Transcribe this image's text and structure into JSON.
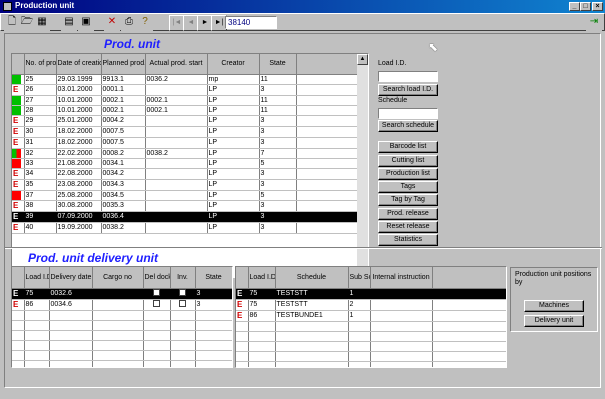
{
  "window": {
    "title": "Production unit"
  },
  "toolbar": {
    "record_counter": "38140",
    "nav_first": "|◄",
    "nav_prev": "◄",
    "nav_next": "►",
    "nav_last": "►|"
  },
  "prod_unit": {
    "heading": "Prod. unit",
    "columns": [
      "No. of prod. unit",
      "Date of creatio",
      "Planned prod.",
      "Actual prod. start",
      "Creator",
      "State"
    ],
    "rows": [
      {
        "no": "25",
        "date": "29.03.1999",
        "planned": "9913.1",
        "actual": "0036.2",
        "creator": "mp",
        "state": "11",
        "status": "green"
      },
      {
        "no": "26",
        "date": "03.01.2000",
        "planned": "0001.1",
        "actual": "",
        "creator": "LP",
        "state": "3",
        "status": "E"
      },
      {
        "no": "27",
        "date": "10.01.2000",
        "planned": "0002.1",
        "actual": "0002.1",
        "creator": "LP",
        "state": "11",
        "status": "green"
      },
      {
        "no": "28",
        "date": "10.01.2000",
        "planned": "0002.1",
        "actual": "0002.1",
        "creator": "LP",
        "state": "11",
        "status": "green"
      },
      {
        "no": "29",
        "date": "25.01.2000",
        "planned": "0004.2",
        "actual": "",
        "creator": "LP",
        "state": "3",
        "status": "E"
      },
      {
        "no": "30",
        "date": "18.02.2000",
        "planned": "0007.5",
        "actual": "",
        "creator": "LP",
        "state": "3",
        "status": "E"
      },
      {
        "no": "31",
        "date": "18.02.2000",
        "planned": "0007.5",
        "actual": "",
        "creator": "LP",
        "state": "3",
        "status": "E"
      },
      {
        "no": "32",
        "date": "22.02.2000",
        "planned": "0008.2",
        "actual": "0038.2",
        "creator": "LP",
        "state": "7",
        "status": "greenred"
      },
      {
        "no": "33",
        "date": "21.08.2000",
        "planned": "0034.1",
        "actual": "",
        "creator": "LP",
        "state": "5",
        "status": "red"
      },
      {
        "no": "34",
        "date": "22.08.2000",
        "planned": "0034.2",
        "actual": "",
        "creator": "LP",
        "state": "3",
        "status": "E"
      },
      {
        "no": "35",
        "date": "23.08.2000",
        "planned": "0034.3",
        "actual": "",
        "creator": "LP",
        "state": "3",
        "status": "E"
      },
      {
        "no": "37",
        "date": "25.08.2000",
        "planned": "0034.5",
        "actual": "",
        "creator": "LP",
        "state": "5",
        "status": "red"
      },
      {
        "no": "38",
        "date": "30.08.2000",
        "planned": "0035.3",
        "actual": "",
        "creator": "LP",
        "state": "3",
        "status": "E"
      },
      {
        "no": "39",
        "date": "07.09.2000",
        "planned": "0036.4",
        "actual": "",
        "creator": "LP",
        "state": "3",
        "status": "E",
        "selected": true
      },
      {
        "no": "40",
        "date": "19.09.2000",
        "planned": "0038.2",
        "actual": "",
        "creator": "LP",
        "state": "3",
        "status": "E"
      }
    ]
  },
  "side": {
    "load_id_label": "Load I.D.",
    "load_id_value": "",
    "search_load_btn": "Search load I.D.",
    "schedule_label": "Schedule",
    "schedule_value": "",
    "search_schedule_btn": "Search schedule",
    "buttons": [
      "Barcode list",
      "Cutting list",
      "Production list",
      "Tags",
      "Tag by Tag",
      "Prod. release",
      "Reset release",
      "Statistics"
    ]
  },
  "delivery": {
    "heading": "Prod. unit delivery unit",
    "columns": [
      "Load I.D",
      "Delivery date",
      "Cargo no",
      "Del docket",
      "Inv.",
      "State"
    ],
    "rows": [
      {
        "load": "75",
        "date": "0032.6",
        "cargo": "",
        "state": "3",
        "status": "E",
        "selected": true
      },
      {
        "load": "86",
        "date": "0034.6",
        "cargo": "",
        "state": "3",
        "status": "E"
      }
    ]
  },
  "schedule": {
    "columns": [
      "Load I.D",
      "Schedule",
      "Sub Sched",
      "Internal instruction"
    ],
    "rows": [
      {
        "load": "75",
        "schedule": "TESTSTT",
        "sub": "1",
        "instr": "",
        "status": "E",
        "selected": true
      },
      {
        "load": "75",
        "schedule": "TESTSTT",
        "sub": "2",
        "instr": "",
        "status": "E"
      },
      {
        "load": "86",
        "schedule": "TESTBUNDE1",
        "sub": "1",
        "instr": "",
        "status": "E"
      }
    ]
  },
  "positions": {
    "label": "Production unit positions by",
    "machines_btn": "Machines",
    "delivery_btn": "Delivery unit"
  },
  "colors": {
    "green": "#00c000",
    "red": "#ff0000",
    "heading": "#2020ff",
    "selection": "#000000"
  }
}
